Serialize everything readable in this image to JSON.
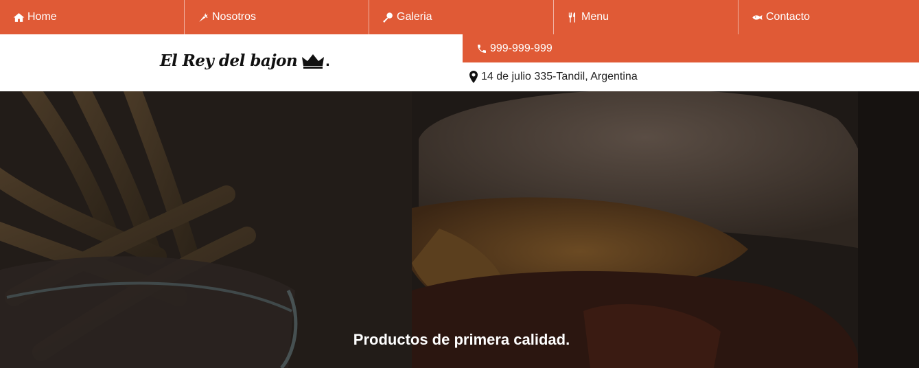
{
  "nav": {
    "items": [
      {
        "label": "Home",
        "icon": "home-icon"
      },
      {
        "label": "Nosotros",
        "icon": "carrot-icon"
      },
      {
        "label": "Galeria",
        "icon": "drumstick-icon"
      },
      {
        "label": "Menu",
        "icon": "cutlery-icon"
      },
      {
        "label": "Contacto",
        "icon": "fish-icon"
      }
    ]
  },
  "header": {
    "brand": "El Rey del bajon",
    "brand_suffix": ".",
    "phone": "999-999-999",
    "address": "14 de julio 335-Tandil, Argentina"
  },
  "hero": {
    "caption": "Productos de primera calidad."
  },
  "colors": {
    "accent": "#e05a36",
    "text_light": "#ffffff",
    "text_dark": "#222222"
  }
}
